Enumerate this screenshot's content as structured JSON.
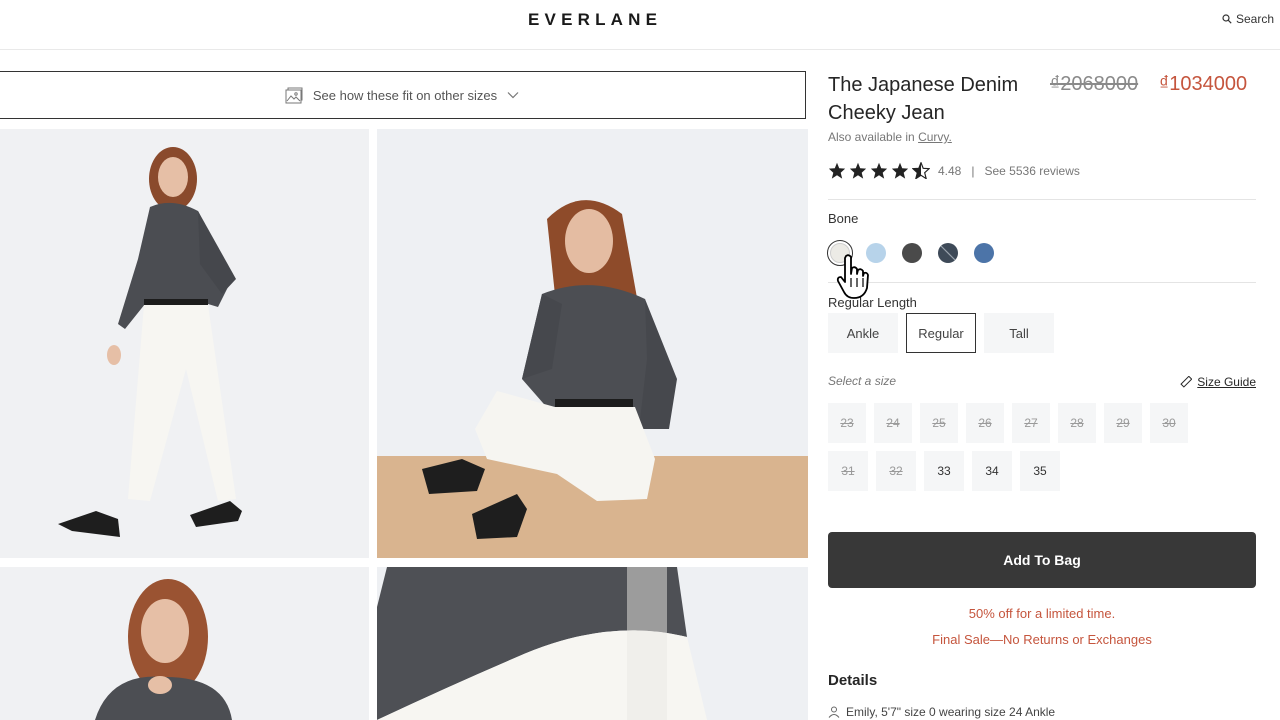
{
  "header": {
    "logo": "EVERLANE",
    "search_label": "Search"
  },
  "fit_bar": {
    "label": "See how these fit on other sizes"
  },
  "product": {
    "title": "The Japanese Denim Cheeky Jean",
    "price_original": "₫2068000",
    "price_sale": "₫1034000",
    "also_available_prefix": "Also available in",
    "also_available_link": "Curvy.",
    "rating_value": "4.48",
    "rating_separator": "|",
    "reviews_link": "See 5536 reviews",
    "stars": 4.5
  },
  "color": {
    "selected_name": "Bone",
    "swatches": [
      {
        "name": "bone",
        "hex": "#ecebe6",
        "selected": true
      },
      {
        "name": "light-blue",
        "hex": "#b7d3ea",
        "selected": false
      },
      {
        "name": "charcoal",
        "hex": "#4a4a4a",
        "selected": false
      },
      {
        "name": "dark-wash",
        "hex": "#3e4a58",
        "selected": false
      },
      {
        "name": "mid-blue",
        "hex": "#4c74a8",
        "selected": false
      }
    ]
  },
  "length": {
    "label": "Regular Length",
    "options": [
      "Ankle",
      "Regular",
      "Tall"
    ],
    "selected": "Regular"
  },
  "size": {
    "label": "Select a size",
    "guide_label": "Size Guide",
    "row1": [
      {
        "label": "23",
        "available": false
      },
      {
        "label": "24",
        "available": false
      },
      {
        "label": "25",
        "available": false
      },
      {
        "label": "26",
        "available": false
      },
      {
        "label": "27",
        "available": false
      },
      {
        "label": "28",
        "available": false
      },
      {
        "label": "29",
        "available": false
      },
      {
        "label": "30",
        "available": false
      }
    ],
    "row2": [
      {
        "label": "31",
        "available": false
      },
      {
        "label": "32",
        "available": false
      },
      {
        "label": "33",
        "available": true
      },
      {
        "label": "34",
        "available": true
      },
      {
        "label": "35",
        "available": true
      }
    ]
  },
  "cta": {
    "add_to_bag": "Add To Bag",
    "promo_line1": "50% off for a limited time.",
    "promo_line2": "Final Sale—No Returns or Exchanges"
  },
  "details": {
    "heading": "Details",
    "model_info": "Emily, 5'7\" size 0 wearing size 24 Ankle"
  },
  "colors": {
    "sale_red": "#c5553d",
    "button_dark": "#383838",
    "chip_bg": "#f5f6f7"
  }
}
